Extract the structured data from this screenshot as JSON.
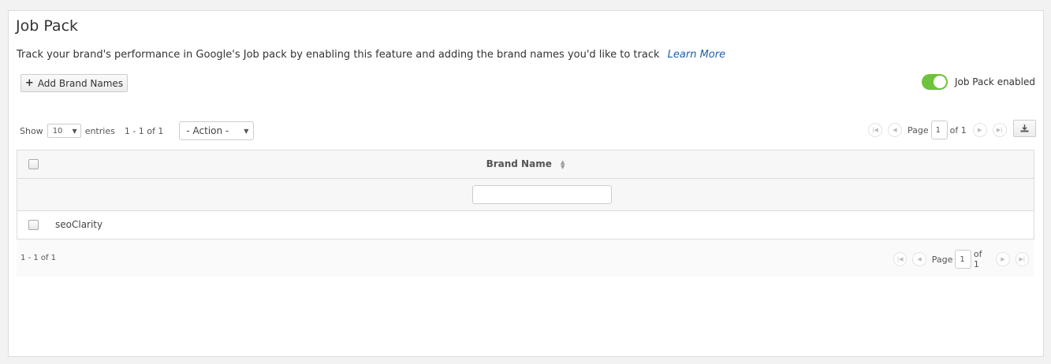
{
  "header": {
    "title": "Job Pack",
    "description": "Track your brand's performance in Google's Job pack by enabling this feature and adding the brand names you'd like to track",
    "learn_more": "Learn More"
  },
  "toolbar": {
    "add_button_label": "Add Brand Names",
    "toggle_label": "Job Pack enabled",
    "toggle_on": true
  },
  "table_controls": {
    "show_label": "Show",
    "entries_value": "10",
    "entries_label": "entries",
    "range_text": "1 - 1 of 1",
    "action_label": "- Action -"
  },
  "pagination": {
    "page_label": "Page",
    "page_value": "1",
    "of_label": "of 1"
  },
  "table": {
    "columns": [
      "Brand Name"
    ],
    "filter_value": "",
    "rows": [
      {
        "brand_name": "seoClarity",
        "checked": false
      }
    ]
  },
  "footer": {
    "range_text": "1 - 1 of 1"
  },
  "colors": {
    "toggle_on": "#6ec33a",
    "link": "#1f5fa8"
  }
}
